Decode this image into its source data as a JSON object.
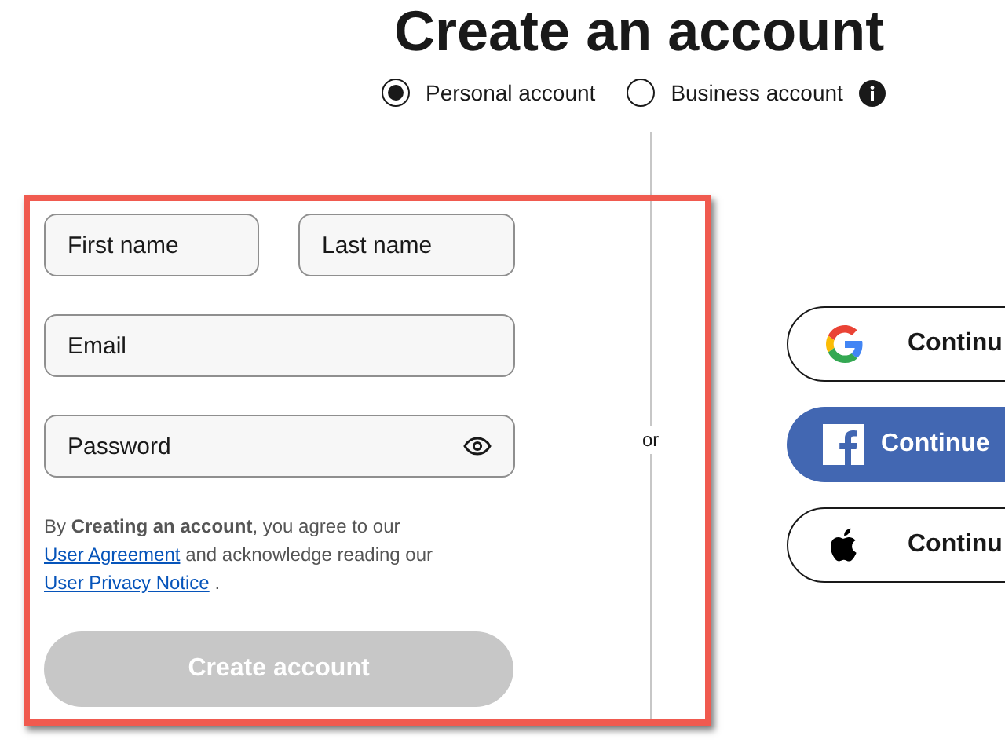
{
  "title": "Create an account",
  "account_types": [
    {
      "label": "Personal account",
      "selected": true
    },
    {
      "label": "Business account",
      "selected": false,
      "info": true
    }
  ],
  "form": {
    "fields": [
      {
        "placeholder": "First name",
        "kind": "text"
      },
      {
        "placeholder": "Last name",
        "kind": "text"
      },
      {
        "placeholder": "Email",
        "kind": "text"
      },
      {
        "placeholder": "Password",
        "kind": "password"
      }
    ],
    "terms": {
      "before": "By **Creating an account**, you agree to our",
      "link1": "User Agreement",
      "middle": "and acknowledge reading our",
      "link2": "User Privacy Notice",
      "end": "."
    },
    "submit": {
      "label": "Create account",
      "disabled": true
    }
  },
  "divider_label": "or",
  "social_buttons": [
    {
      "kind": "google",
      "label": "Continu"
    },
    {
      "kind": "facebook",
      "label": "Continue"
    },
    {
      "kind": "apple",
      "label": "Continu"
    }
  ],
  "highlight": true
}
